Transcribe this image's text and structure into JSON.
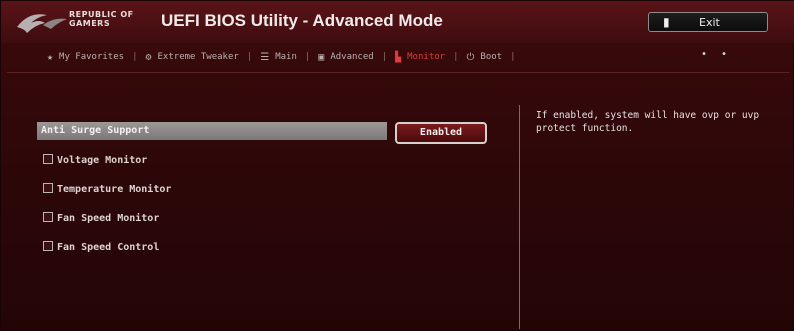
{
  "header": {
    "brand_line1": "REPUBLIC OF",
    "brand_line2": "GAMERS",
    "title": "UEFI BIOS Utility - Advanced Mode",
    "exit_label": "Exit"
  },
  "tabs": [
    {
      "label": "My Favorites",
      "icon": "star-icon",
      "active": false
    },
    {
      "label": "Extreme Tweaker",
      "icon": "tweaker-icon",
      "active": false
    },
    {
      "label": "Main",
      "icon": "list-icon",
      "active": false
    },
    {
      "label": "Advanced",
      "icon": "advanced-icon",
      "active": false
    },
    {
      "label": "Monitor",
      "icon": "monitor-icon",
      "active": true
    },
    {
      "label": "Boot",
      "icon": "power-icon",
      "active": false
    }
  ],
  "more_indicator": "• •",
  "settings": {
    "selected_label": "Anti Surge Support",
    "selected_value": "Enabled",
    "items": [
      {
        "label": "Voltage Monitor"
      },
      {
        "label": "Temperature Monitor"
      },
      {
        "label": "Fan Speed Monitor"
      },
      {
        "label": "Fan Speed Control"
      }
    ]
  },
  "help_text": "If enabled, system will have ovp or uvp protect function.",
  "colors": {
    "accent": "#e03c3c",
    "background": "#2c0708"
  }
}
